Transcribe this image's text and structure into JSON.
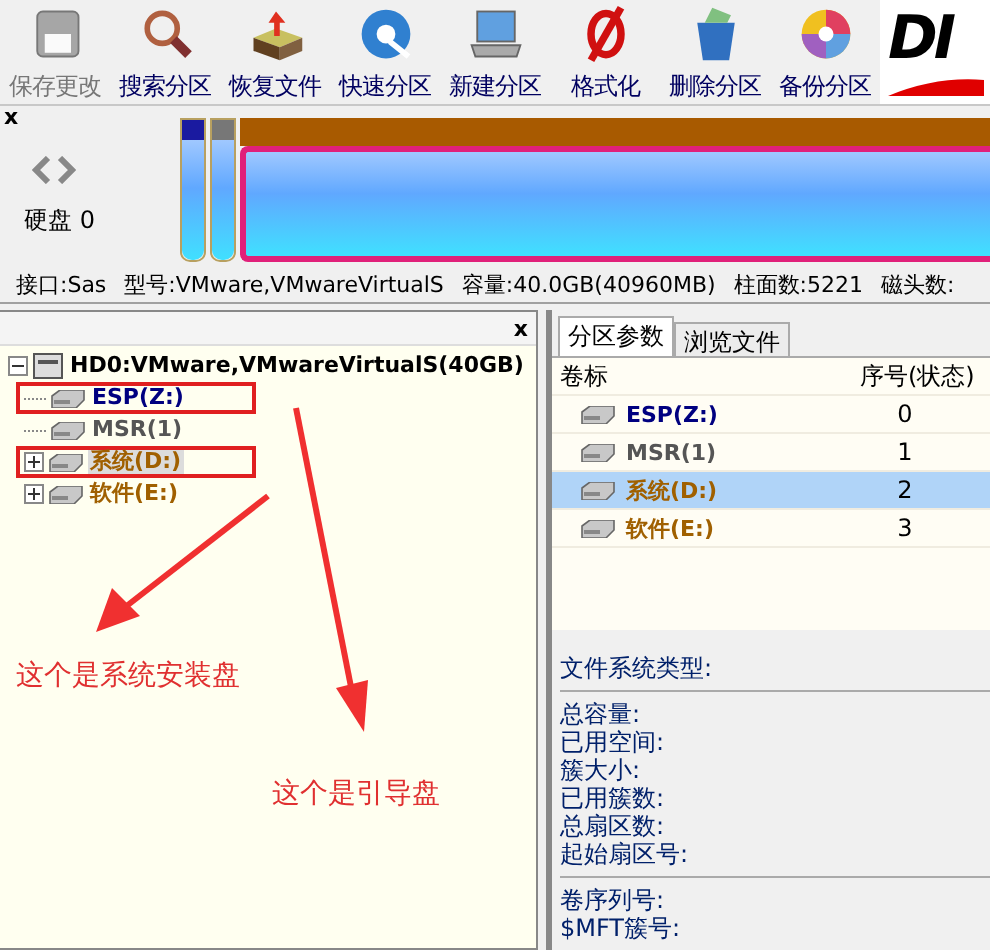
{
  "toolbar": {
    "buttons": [
      {
        "label": "保存更改",
        "disabled": true
      },
      {
        "label": "搜索分区",
        "disabled": false
      },
      {
        "label": "恢复文件",
        "disabled": false
      },
      {
        "label": "快速分区",
        "disabled": false
      },
      {
        "label": "新建分区",
        "disabled": false
      },
      {
        "label": "格式化",
        "disabled": false
      },
      {
        "label": "删除分区",
        "disabled": false
      },
      {
        "label": "备份分区",
        "disabled": false
      }
    ],
    "logo_text": "DI"
  },
  "disk_map": {
    "close": "x",
    "disk_label": "硬盘 0",
    "partitions": [
      {
        "color": "#1a1aa0",
        "selected": false
      },
      {
        "color": "#777777",
        "selected": false
      },
      {
        "color": "#a85a00",
        "selected": true
      }
    ]
  },
  "disk_info": [
    "接口:Sas",
    "型号:VMware,VMwareVirtualS",
    "容量:40.0GB(40960MB)",
    "柱面数:5221",
    "磁头数:"
  ],
  "tree": {
    "close": "x",
    "root": {
      "label": "HD0:VMware,VMwareVirtualS(40GB)",
      "expanded": true,
      "children": [
        {
          "label": "ESP(Z:)",
          "color": "#000080",
          "expandable": false,
          "selected": false,
          "boxed": true
        },
        {
          "label": "MSR(1)",
          "color": "#555555",
          "expandable": false,
          "selected": false,
          "boxed": false
        },
        {
          "label": "系统(D:)",
          "color": "#a06000",
          "expandable": true,
          "selected": true,
          "boxed": true
        },
        {
          "label": "软件(E:)",
          "color": "#a06000",
          "expandable": true,
          "selected": false,
          "boxed": false
        }
      ]
    }
  },
  "annotations": [
    "这个是系统安装盘",
    "这个是引导盘"
  ],
  "tabs": [
    {
      "label": "分区参数",
      "selected": true
    },
    {
      "label": "浏览文件",
      "selected": false
    }
  ],
  "table": {
    "columns": [
      "卷标",
      "序号(状态)"
    ],
    "rows": [
      {
        "label": "ESP(Z:)",
        "color": "#000080",
        "number": "0",
        "selected": false
      },
      {
        "label": "MSR(1)",
        "color": "#555555",
        "number": "1",
        "selected": false
      },
      {
        "label": "系统(D:)",
        "color": "#a06000",
        "number": "2",
        "selected": true
      },
      {
        "label": "软件(E:)",
        "color": "#a06000",
        "number": "3",
        "selected": false
      }
    ]
  },
  "details": [
    [
      "文件系统类型:"
    ],
    [
      "总容量:",
      "已用空间:",
      "簇大小:",
      "已用簇数:",
      "总扇区数:",
      "起始扇区号:"
    ],
    [
      "卷序列号:",
      "$MFT簇号:"
    ]
  ]
}
